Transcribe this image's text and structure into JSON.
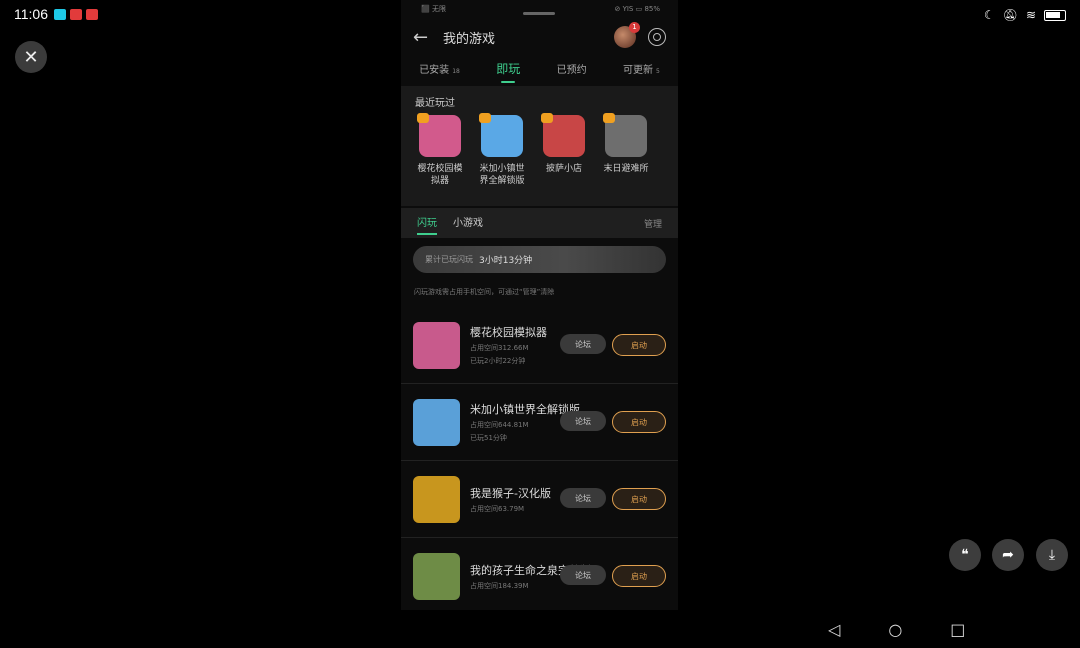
{
  "system": {
    "time": "11:06",
    "notif_colors": [
      "#1ec8e6",
      "#e23b3b",
      "#e23b3b"
    ]
  },
  "phone_status": {
    "left": "⬛ 无限",
    "right": "⊘ YIS ▭ 85%"
  },
  "header": {
    "title": "我的游戏",
    "avatar_badge": "1"
  },
  "tabs": [
    {
      "label": "已安装",
      "count": "18"
    },
    {
      "label": "即玩",
      "count": ""
    },
    {
      "label": "已预约",
      "count": ""
    },
    {
      "label": "可更新",
      "count": "5"
    }
  ],
  "recent": {
    "title": "最近玩过",
    "items": [
      {
        "name": "樱花校园模拟器",
        "color": "#d25a8c"
      },
      {
        "name": "米加小镇世界全解锁版",
        "color": "#5aa8e6"
      },
      {
        "name": "披萨小店",
        "color": "#c84646"
      },
      {
        "name": "末日避难所",
        "color": "#6e6e6e"
      }
    ]
  },
  "sub_tabs": {
    "flash": "闪玩",
    "mini": "小游戏",
    "manage": "管理"
  },
  "usage": {
    "label": "累计已玩闪玩",
    "value": "3小时13分钟"
  },
  "hint": "闪玩游戏需占用手机空间，可通过“管理”清除",
  "games": [
    {
      "name": "樱花校园模拟器",
      "space": "占用空间312.66M",
      "played": "已玩2小时22分钟",
      "color": "#c85a8c"
    },
    {
      "name": "米加小镇世界全解锁版",
      "space": "占用空间644.81M",
      "played": "已玩51分钟",
      "color": "#5aa0d8"
    },
    {
      "name": "我是猴子-汉化版",
      "space": "占用空间63.79M",
      "played": "",
      "color": "#c8961e"
    },
    {
      "name": "我的孩子生命之泉完整版",
      "space": "占用空间184.39M",
      "played": "",
      "color": "#6e8c46"
    }
  ],
  "buttons": {
    "forum": "论坛",
    "launch": "启动"
  },
  "icons": {
    "close": "✕",
    "back": "←",
    "quote": "❝",
    "share": "➦",
    "download": "⤓",
    "nav_back": "◁",
    "nav_home": "○",
    "nav_recent": "□"
  }
}
